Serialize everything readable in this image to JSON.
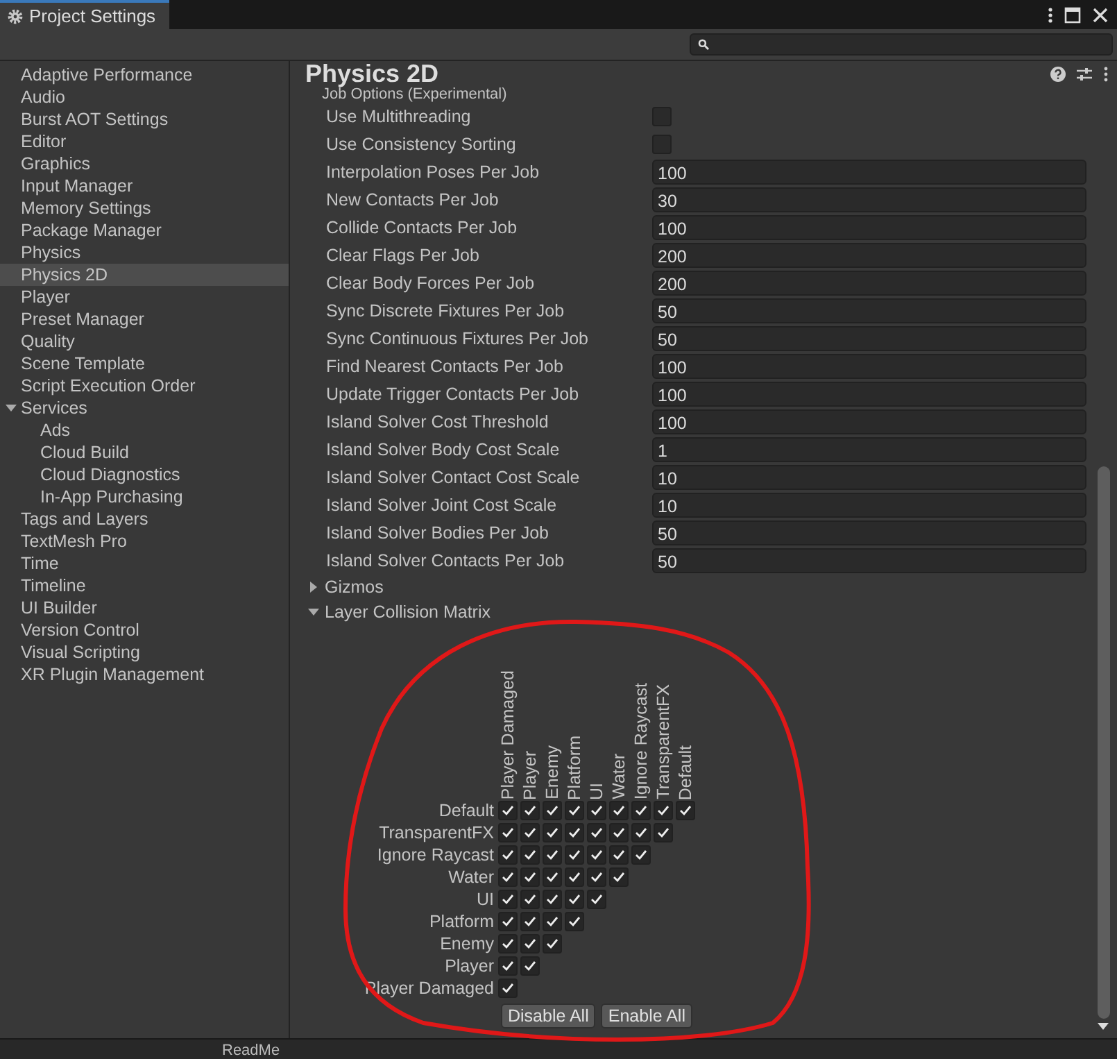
{
  "window": {
    "title": "Project Settings"
  },
  "sidebar": {
    "items": [
      {
        "label": "Adaptive Performance",
        "selected": false
      },
      {
        "label": "Audio",
        "selected": false
      },
      {
        "label": "Burst AOT Settings",
        "selected": false
      },
      {
        "label": "Editor",
        "selected": false
      },
      {
        "label": "Graphics",
        "selected": false
      },
      {
        "label": "Input Manager",
        "selected": false
      },
      {
        "label": "Memory Settings",
        "selected": false
      },
      {
        "label": "Package Manager",
        "selected": false
      },
      {
        "label": "Physics",
        "selected": false
      },
      {
        "label": "Physics 2D",
        "selected": true
      },
      {
        "label": "Player",
        "selected": false
      },
      {
        "label": "Preset Manager",
        "selected": false
      },
      {
        "label": "Quality",
        "selected": false
      },
      {
        "label": "Scene Template",
        "selected": false
      },
      {
        "label": "Script Execution Order",
        "selected": false
      },
      {
        "label": "Services",
        "selected": false,
        "expanded": true,
        "children": [
          {
            "label": "Ads",
            "selected": false
          },
          {
            "label": "Cloud Build",
            "selected": false
          },
          {
            "label": "Cloud Diagnostics",
            "selected": false
          },
          {
            "label": "In-App Purchasing",
            "selected": false
          }
        ]
      },
      {
        "label": "Tags and Layers",
        "selected": false
      },
      {
        "label": "TextMesh Pro",
        "selected": false
      },
      {
        "label": "Time",
        "selected": false
      },
      {
        "label": "Timeline",
        "selected": false
      },
      {
        "label": "UI Builder",
        "selected": false
      },
      {
        "label": "Version Control",
        "selected": false
      },
      {
        "label": "Visual Scripting",
        "selected": false
      },
      {
        "label": "XR Plugin Management",
        "selected": false
      }
    ]
  },
  "panel": {
    "title": "Physics 2D",
    "section": "Job Options (Experimental)",
    "rows": [
      {
        "kind": "checkbox",
        "label": "Use Multithreading",
        "checked": false
      },
      {
        "kind": "checkbox",
        "label": "Use Consistency Sorting",
        "checked": false
      },
      {
        "kind": "number",
        "label": "Interpolation Poses Per Job",
        "value": "100"
      },
      {
        "kind": "number",
        "label": "New Contacts Per Job",
        "value": "30"
      },
      {
        "kind": "number",
        "label": "Collide Contacts Per Job",
        "value": "100"
      },
      {
        "kind": "number",
        "label": "Clear Flags Per Job",
        "value": "200"
      },
      {
        "kind": "number",
        "label": "Clear Body Forces Per Job",
        "value": "200"
      },
      {
        "kind": "number",
        "label": "Sync Discrete Fixtures Per Job",
        "value": "50"
      },
      {
        "kind": "number",
        "label": "Sync Continuous Fixtures Per Job",
        "value": "50"
      },
      {
        "kind": "number",
        "label": "Find Nearest Contacts Per Job",
        "value": "100"
      },
      {
        "kind": "number",
        "label": "Update Trigger Contacts Per Job",
        "value": "100"
      },
      {
        "kind": "number",
        "label": "Island Solver Cost Threshold",
        "value": "100"
      },
      {
        "kind": "number",
        "label": "Island Solver Body Cost Scale",
        "value": "1"
      },
      {
        "kind": "number",
        "label": "Island Solver Contact Cost Scale",
        "value": "10"
      },
      {
        "kind": "number",
        "label": "Island Solver Joint Cost Scale",
        "value": "10"
      },
      {
        "kind": "number",
        "label": "Island Solver Bodies Per Job",
        "value": "50"
      },
      {
        "kind": "number",
        "label": "Island Solver Contacts Per Job",
        "value": "50"
      }
    ],
    "foldouts": [
      {
        "label": "Gizmos",
        "expanded": false
      },
      {
        "label": "Layer Collision Matrix",
        "expanded": true
      }
    ],
    "matrix": {
      "columns": [
        "Player Damaged",
        "Player",
        "Enemy",
        "Platform",
        "UI",
        "Water",
        "Ignore Raycast",
        "TransparentFX",
        "Default"
      ],
      "rows": [
        {
          "label": "Default",
          "cells": [
            true,
            true,
            true,
            true,
            true,
            true,
            true,
            true,
            true
          ]
        },
        {
          "label": "TransparentFX",
          "cells": [
            true,
            true,
            true,
            true,
            true,
            true,
            true,
            true
          ]
        },
        {
          "label": "Ignore Raycast",
          "cells": [
            true,
            true,
            true,
            true,
            true,
            true,
            true
          ]
        },
        {
          "label": "Water",
          "cells": [
            true,
            true,
            true,
            true,
            true,
            true
          ]
        },
        {
          "label": "UI",
          "cells": [
            true,
            true,
            true,
            true,
            true
          ]
        },
        {
          "label": "Platform",
          "cells": [
            true,
            true,
            true,
            true
          ]
        },
        {
          "label": "Enemy",
          "cells": [
            true,
            true,
            true
          ]
        },
        {
          "label": "Player",
          "cells": [
            true,
            true
          ]
        },
        {
          "label": "Player Damaged",
          "cells": [
            true
          ]
        }
      ],
      "buttons": [
        "Disable All",
        "Enable All"
      ]
    }
  },
  "bottom": {
    "label": "ReadMe"
  }
}
